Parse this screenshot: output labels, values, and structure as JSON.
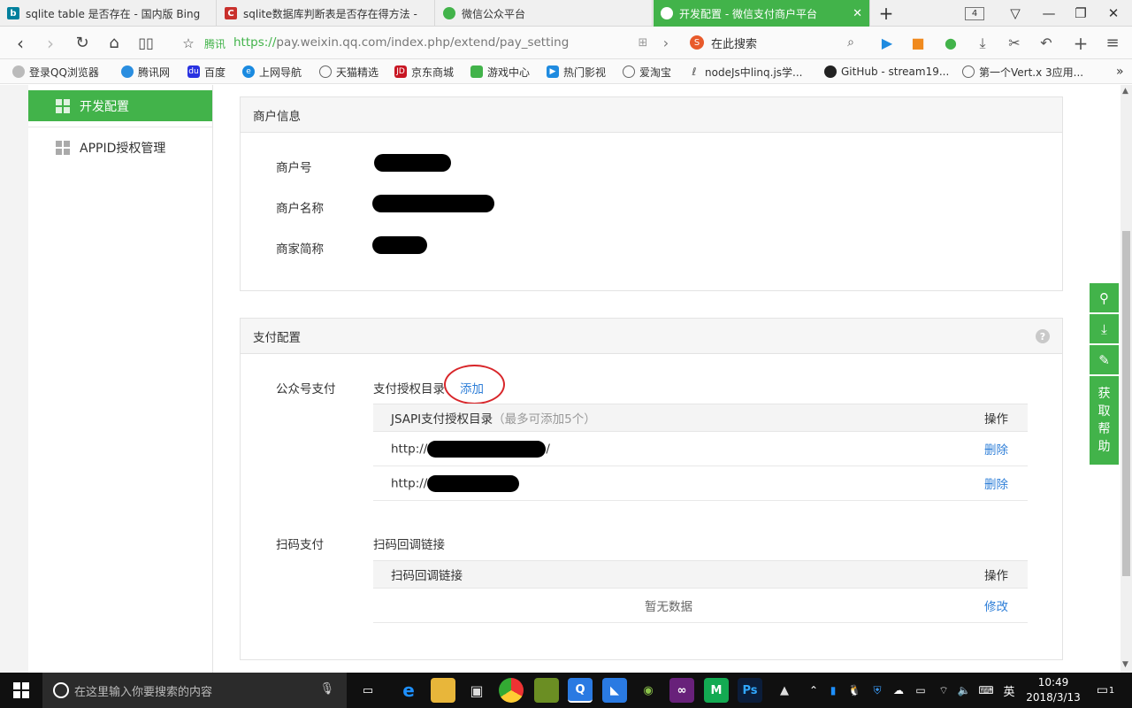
{
  "browser": {
    "tabs": [
      {
        "title": "sqlite table 是否存在 - 国内版 Bing",
        "icon": "bing-icon",
        "color": "#00809d"
      },
      {
        "title": "sqlite数据库判断表是否存在得方法 -",
        "icon": "csdn-icon",
        "color": "#c9302c"
      },
      {
        "title": "微信公众平台",
        "icon": "wechat-icon",
        "color": "#42b34a"
      },
      {
        "title": "开发配置 - 微信支付商户平台",
        "icon": "wechat-icon",
        "color": "#ffffff",
        "active": true
      }
    ],
    "tab_count": "4",
    "url_host": "腾讯",
    "url_proto": "https://",
    "url_rest": "pay.weixin.qq.com/index.php/extend/pay_setting",
    "search_label": "在此搜索",
    "bookmarks": [
      "登录QQ浏览器",
      "腾讯网",
      "百度",
      "上网导航",
      "天猫精选",
      "京东商城",
      "游戏中心",
      "热门影视",
      "爱淘宝",
      "nodeJs中linq.js学...",
      "GitHub - stream19...",
      "第一个Vert.x 3应用..."
    ]
  },
  "sidebar": {
    "items": [
      {
        "label": "开发配置",
        "active": true
      },
      {
        "label": "APPID授权管理",
        "active": false
      }
    ]
  },
  "merchant_panel": {
    "title": "商户信息",
    "fields": [
      "商户号",
      "商户名称",
      "商家简称"
    ]
  },
  "pay_panel": {
    "title": "支付配置",
    "jsapi": {
      "section_label": "公众号支付",
      "dir_label": "支付授权目录",
      "add_link": "添加",
      "header": "JSAPI支付授权目录",
      "header_note": "（最多可添加5个）",
      "action_header": "操作",
      "rows": [
        {
          "prefix": "http://",
          "suffix": "/",
          "action": "删除"
        },
        {
          "prefix": "http://",
          "suffix": "",
          "action": "删除"
        }
      ]
    },
    "scan": {
      "section_label": "扫码支付",
      "sub_label": "扫码回调链接",
      "header": "扫码回调链接",
      "action_header": "操作",
      "empty": "暂无数据",
      "action": "修改"
    }
  },
  "float_tools": {
    "help_label": [
      "获",
      "取",
      "帮",
      "助"
    ]
  },
  "taskbar": {
    "search_placeholder": "在这里输入你要搜索的内容",
    "ime": "英",
    "time": "10:49",
    "date": "2018/3/13",
    "notifications": "1"
  }
}
